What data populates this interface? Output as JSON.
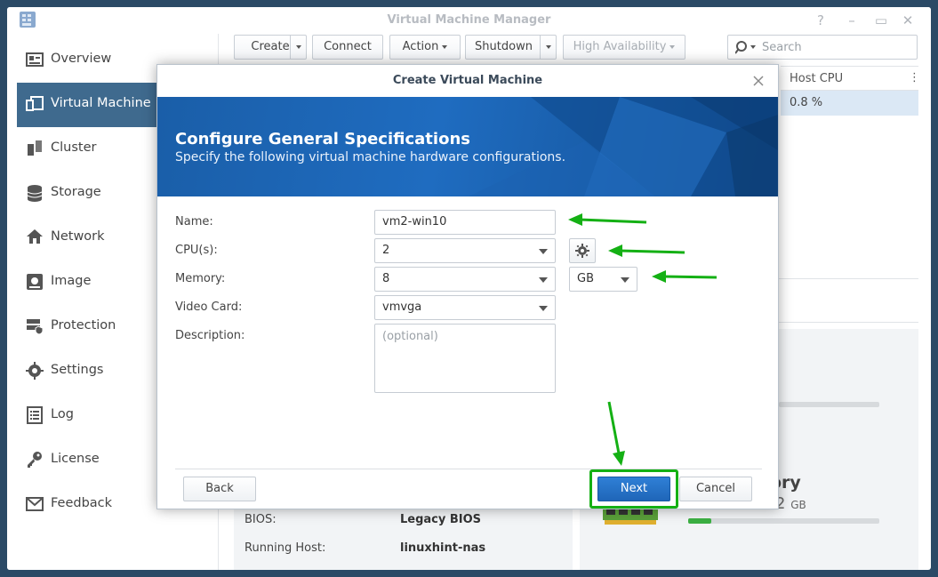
{
  "app": {
    "title": "Virtual Machine Manager"
  },
  "sidebar": {
    "items": [
      {
        "label": "Overview",
        "icon": "overview-icon"
      },
      {
        "label": "Virtual Machine",
        "icon": "vm-icon"
      },
      {
        "label": "Cluster",
        "icon": "cluster-icon"
      },
      {
        "label": "Storage",
        "icon": "storage-icon"
      },
      {
        "label": "Network",
        "icon": "network-icon"
      },
      {
        "label": "Image",
        "icon": "image-icon"
      },
      {
        "label": "Protection",
        "icon": "protection-icon"
      },
      {
        "label": "Settings",
        "icon": "settings-icon"
      },
      {
        "label": "Log",
        "icon": "log-icon"
      },
      {
        "label": "License",
        "icon": "license-icon"
      },
      {
        "label": "Feedback",
        "icon": "feedback-icon"
      }
    ],
    "active_index": 1
  },
  "toolbar": {
    "create": "Create",
    "connect": "Connect",
    "action": "Action",
    "shutdown": "Shutdown",
    "high_availability": "High Availability",
    "search_placeholder": "Search"
  },
  "grid": {
    "column_host_cpu": "Host CPU",
    "row_host_cpu": "0.8 %"
  },
  "background_details": {
    "bios_label": "BIOS:",
    "bios_value": "Legacy BIOS",
    "running_host_label": "Running Host:",
    "running_host_value": "linuxhint-nas",
    "memory_partial": "ory",
    "memory_value_partial": "2",
    "memory_unit": "GB"
  },
  "dialog": {
    "title": "Create Virtual Machine",
    "banner_title": "Configure General Specifications",
    "banner_subtitle": "Specify the following virtual machine hardware configurations.",
    "form": {
      "name_label": "Name:",
      "name_value": "vm2-win10",
      "cpu_label": "CPU(s):",
      "cpu_value": "2",
      "memory_label": "Memory:",
      "memory_value": "8",
      "memory_unit": "GB",
      "video_card_label": "Video Card:",
      "video_card_value": "vmvga",
      "description_label": "Description:",
      "description_placeholder": "(optional)"
    },
    "buttons": {
      "back": "Back",
      "next": "Next",
      "cancel": "Cancel"
    }
  },
  "colors": {
    "annotation_green": "#14b014",
    "sidebar_active": "#3f6a8e",
    "primary_button": "#1f66b8"
  }
}
